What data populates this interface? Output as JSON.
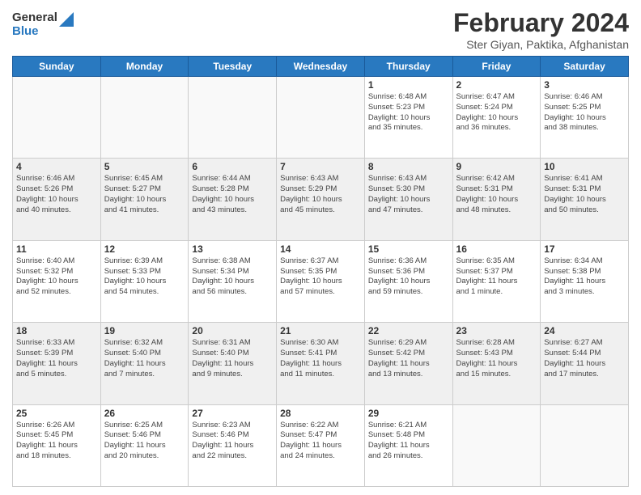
{
  "header": {
    "logo_general": "General",
    "logo_blue": "Blue",
    "title": "February 2024",
    "subtitle": "Ster Giyan, Paktika, Afghanistan"
  },
  "weekdays": [
    "Sunday",
    "Monday",
    "Tuesday",
    "Wednesday",
    "Thursday",
    "Friday",
    "Saturday"
  ],
  "weeks": [
    [
      {
        "day": "",
        "info": ""
      },
      {
        "day": "",
        "info": ""
      },
      {
        "day": "",
        "info": ""
      },
      {
        "day": "",
        "info": ""
      },
      {
        "day": "1",
        "info": "Sunrise: 6:48 AM\nSunset: 5:23 PM\nDaylight: 10 hours\nand 35 minutes."
      },
      {
        "day": "2",
        "info": "Sunrise: 6:47 AM\nSunset: 5:24 PM\nDaylight: 10 hours\nand 36 minutes."
      },
      {
        "day": "3",
        "info": "Sunrise: 6:46 AM\nSunset: 5:25 PM\nDaylight: 10 hours\nand 38 minutes."
      }
    ],
    [
      {
        "day": "4",
        "info": "Sunrise: 6:46 AM\nSunset: 5:26 PM\nDaylight: 10 hours\nand 40 minutes."
      },
      {
        "day": "5",
        "info": "Sunrise: 6:45 AM\nSunset: 5:27 PM\nDaylight: 10 hours\nand 41 minutes."
      },
      {
        "day": "6",
        "info": "Sunrise: 6:44 AM\nSunset: 5:28 PM\nDaylight: 10 hours\nand 43 minutes."
      },
      {
        "day": "7",
        "info": "Sunrise: 6:43 AM\nSunset: 5:29 PM\nDaylight: 10 hours\nand 45 minutes."
      },
      {
        "day": "8",
        "info": "Sunrise: 6:43 AM\nSunset: 5:30 PM\nDaylight: 10 hours\nand 47 minutes."
      },
      {
        "day": "9",
        "info": "Sunrise: 6:42 AM\nSunset: 5:31 PM\nDaylight: 10 hours\nand 48 minutes."
      },
      {
        "day": "10",
        "info": "Sunrise: 6:41 AM\nSunset: 5:31 PM\nDaylight: 10 hours\nand 50 minutes."
      }
    ],
    [
      {
        "day": "11",
        "info": "Sunrise: 6:40 AM\nSunset: 5:32 PM\nDaylight: 10 hours\nand 52 minutes."
      },
      {
        "day": "12",
        "info": "Sunrise: 6:39 AM\nSunset: 5:33 PM\nDaylight: 10 hours\nand 54 minutes."
      },
      {
        "day": "13",
        "info": "Sunrise: 6:38 AM\nSunset: 5:34 PM\nDaylight: 10 hours\nand 56 minutes."
      },
      {
        "day": "14",
        "info": "Sunrise: 6:37 AM\nSunset: 5:35 PM\nDaylight: 10 hours\nand 57 minutes."
      },
      {
        "day": "15",
        "info": "Sunrise: 6:36 AM\nSunset: 5:36 PM\nDaylight: 10 hours\nand 59 minutes."
      },
      {
        "day": "16",
        "info": "Sunrise: 6:35 AM\nSunset: 5:37 PM\nDaylight: 11 hours\nand 1 minute."
      },
      {
        "day": "17",
        "info": "Sunrise: 6:34 AM\nSunset: 5:38 PM\nDaylight: 11 hours\nand 3 minutes."
      }
    ],
    [
      {
        "day": "18",
        "info": "Sunrise: 6:33 AM\nSunset: 5:39 PM\nDaylight: 11 hours\nand 5 minutes."
      },
      {
        "day": "19",
        "info": "Sunrise: 6:32 AM\nSunset: 5:40 PM\nDaylight: 11 hours\nand 7 minutes."
      },
      {
        "day": "20",
        "info": "Sunrise: 6:31 AM\nSunset: 5:40 PM\nDaylight: 11 hours\nand 9 minutes."
      },
      {
        "day": "21",
        "info": "Sunrise: 6:30 AM\nSunset: 5:41 PM\nDaylight: 11 hours\nand 11 minutes."
      },
      {
        "day": "22",
        "info": "Sunrise: 6:29 AM\nSunset: 5:42 PM\nDaylight: 11 hours\nand 13 minutes."
      },
      {
        "day": "23",
        "info": "Sunrise: 6:28 AM\nSunset: 5:43 PM\nDaylight: 11 hours\nand 15 minutes."
      },
      {
        "day": "24",
        "info": "Sunrise: 6:27 AM\nSunset: 5:44 PM\nDaylight: 11 hours\nand 17 minutes."
      }
    ],
    [
      {
        "day": "25",
        "info": "Sunrise: 6:26 AM\nSunset: 5:45 PM\nDaylight: 11 hours\nand 18 minutes."
      },
      {
        "day": "26",
        "info": "Sunrise: 6:25 AM\nSunset: 5:46 PM\nDaylight: 11 hours\nand 20 minutes."
      },
      {
        "day": "27",
        "info": "Sunrise: 6:23 AM\nSunset: 5:46 PM\nDaylight: 11 hours\nand 22 minutes."
      },
      {
        "day": "28",
        "info": "Sunrise: 6:22 AM\nSunset: 5:47 PM\nDaylight: 11 hours\nand 24 minutes."
      },
      {
        "day": "29",
        "info": "Sunrise: 6:21 AM\nSunset: 5:48 PM\nDaylight: 11 hours\nand 26 minutes."
      },
      {
        "day": "",
        "info": ""
      },
      {
        "day": "",
        "info": ""
      }
    ]
  ]
}
